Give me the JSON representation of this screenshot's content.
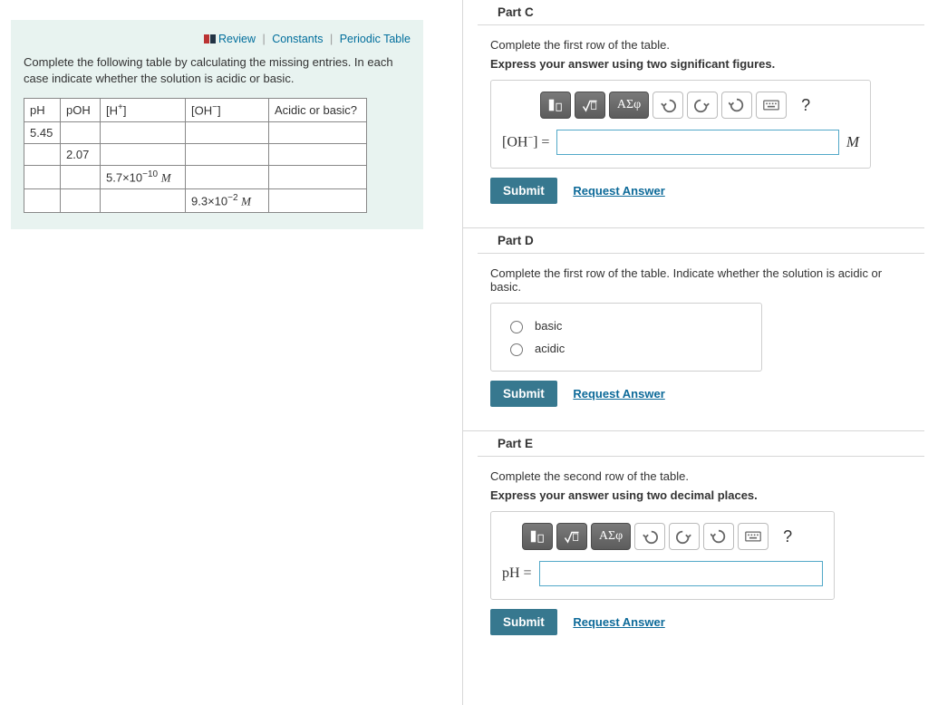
{
  "left": {
    "links": {
      "review": "Review",
      "constants": "Constants",
      "periodic": "Periodic Table"
    },
    "instructions": "Complete the following table by calculating the missing entries. In each case indicate whether the solution is acidic or basic.",
    "headers": {
      "ph": "pH",
      "poh": "pOH",
      "h": "[H",
      "oh": "[OH",
      "state": "Acidic or basic?"
    },
    "rows": [
      {
        "ph": "5.45",
        "poh": "",
        "h": "",
        "oh": "",
        "state": ""
      },
      {
        "ph": "",
        "poh": "2.07",
        "h": "",
        "oh": "",
        "state": ""
      },
      {
        "ph": "",
        "poh": "",
        "h": "5.7×10",
        "h_exp": "−10",
        "h_unit": "M",
        "oh": "",
        "state": ""
      },
      {
        "ph": "",
        "poh": "",
        "h": "",
        "oh": "9.3×10",
        "oh_exp": "−2",
        "oh_unit": "M",
        "state": ""
      }
    ]
  },
  "partC": {
    "title": "Part C",
    "prompt1": "Complete the first row of the table.",
    "prompt2": "Express your answer using two significant figures.",
    "var_label_pre": "[OH",
    "var_label_post": "] =",
    "unit": "M",
    "toolbar_greek": "ΑΣφ",
    "submit": "Submit",
    "request": "Request Answer"
  },
  "partD": {
    "title": "Part D",
    "prompt": "Complete the first row of the table. Indicate whether the solution is acidic or basic.",
    "opt1": "basic",
    "opt2": "acidic",
    "submit": "Submit",
    "request": "Request Answer"
  },
  "partE": {
    "title": "Part E",
    "prompt1": "Complete the second row of the table.",
    "prompt2": "Express your answer using two decimal places.",
    "var_label": "pH =",
    "toolbar_greek": "ΑΣφ",
    "submit": "Submit",
    "request": "Request Answer"
  }
}
